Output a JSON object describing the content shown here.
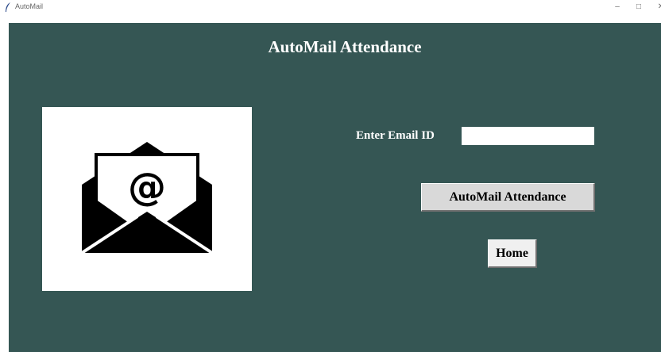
{
  "window": {
    "title": "AutoMail",
    "minimize_icon": "minimize-icon",
    "maximize_icon": "maximize-icon",
    "close_icon": "close-icon"
  },
  "main": {
    "title": "AutoMail Attendance",
    "email_label": "Enter Email ID",
    "email_value": "",
    "automail_button_label": "AutoMail Attendance",
    "home_button_label": "Home"
  },
  "colors": {
    "background": "#355654",
    "text": "#ffffff",
    "button": "#d9d9d9"
  },
  "icons": {
    "app": "feather-icon",
    "illustration": "email-envelope-icon"
  }
}
